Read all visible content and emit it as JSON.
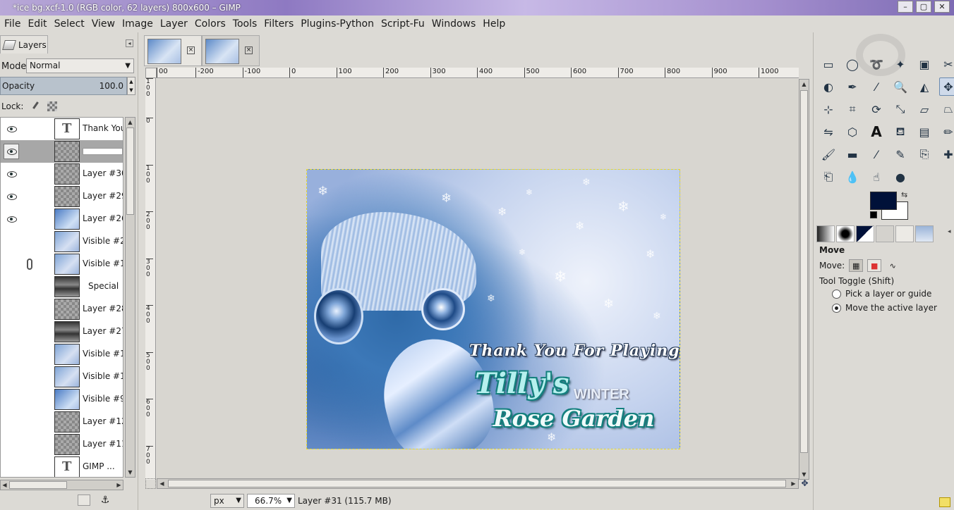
{
  "window": {
    "title": "*ice bg.xcf-1.0 (RGB color, 62 layers) 800x600 – GIMP",
    "buttons": [
      "–",
      "▢",
      "✕"
    ]
  },
  "menubar": {
    "items": [
      "File",
      "Edit",
      "Select",
      "View",
      "Image",
      "Layer",
      "Colors",
      "Tools",
      "Filters",
      "Plugins-Python",
      "Script-Fu",
      "Windows",
      "Help"
    ]
  },
  "layers_dock": {
    "tab_label": "Layers",
    "mode_label": "Mode:",
    "mode_value": "Normal",
    "opacity_label": "Opacity",
    "opacity_value": "100.0",
    "lock_label": "Lock:",
    "layers": [
      {
        "name": "Thank You",
        "visible": true,
        "thumb": "text"
      },
      {
        "name": "",
        "visible": true,
        "thumb": "checker",
        "selected": true,
        "editing": true
      },
      {
        "name": "Layer #30",
        "visible": true,
        "thumb": "checker"
      },
      {
        "name": "Layer #29",
        "visible": true,
        "thumb": "checker"
      },
      {
        "name": "Layer #26",
        "visible": true,
        "thumb": "img"
      },
      {
        "name": "Visible #2",
        "visible": false,
        "thumb": "blue"
      },
      {
        "name": "Visible #1",
        "visible": false,
        "thumb": "blue",
        "linked": true
      },
      {
        "name": "Special",
        "visible": false,
        "thumb": "dark",
        "indent": true
      },
      {
        "name": "Layer #28",
        "visible": false,
        "thumb": "checker"
      },
      {
        "name": "Layer #27",
        "visible": false,
        "thumb": "dark"
      },
      {
        "name": "Visible #1",
        "visible": false,
        "thumb": "blue"
      },
      {
        "name": "Visible #1",
        "visible": false,
        "thumb": "blue"
      },
      {
        "name": "Visible #9",
        "visible": false,
        "thumb": "img"
      },
      {
        "name": "Layer #12",
        "visible": false,
        "thumb": "checker"
      },
      {
        "name": "Layer #11",
        "visible": false,
        "thumb": "checker"
      },
      {
        "name": "GIMP ...",
        "visible": false,
        "thumb": "text"
      }
    ]
  },
  "ruler": {
    "h_labels": [
      "00",
      "-200",
      "-100",
      "0",
      "100",
      "200",
      "300",
      "400",
      "500",
      "600",
      "700",
      "800",
      "900",
      "1000"
    ],
    "v_labels": [
      "100",
      "0",
      "100",
      "200",
      "300",
      "400",
      "500",
      "600",
      "700"
    ]
  },
  "canvas_text": {
    "thanks": "Thank You For Playing",
    "tilly": "Tilly's",
    "winter": "WINTER",
    "rose": "Rose Garden"
  },
  "statusbar": {
    "unit": "px",
    "zoom": "66.7%",
    "status": "Layer #31 (115.7 MB)"
  },
  "toolbox": {
    "tools": [
      "rect-select",
      "ellipse-select",
      "free-select",
      "fuzzy-select",
      "select-by-color",
      "scissors",
      "foreground-select",
      "paths",
      "color-picker",
      "zoom",
      "measure",
      "move",
      "align",
      "crop",
      "rotate",
      "scale",
      "shear",
      "perspective",
      "flip",
      "cage",
      "text",
      "bucket-fill",
      "blend",
      "pencil",
      "paintbrush",
      "eraser",
      "airbrush",
      "ink",
      "clone",
      "heal",
      "perspective-clone",
      "blur",
      "smudge",
      "dodge-burn"
    ],
    "fg_color": "#001139",
    "bg_color": "#ffffff",
    "options_title": "Move",
    "move_label": "Move:",
    "toggle_label": "Tool Toggle  (Shift)",
    "radio_pick": "Pick a layer or guide",
    "radio_move": "Move the active layer"
  }
}
